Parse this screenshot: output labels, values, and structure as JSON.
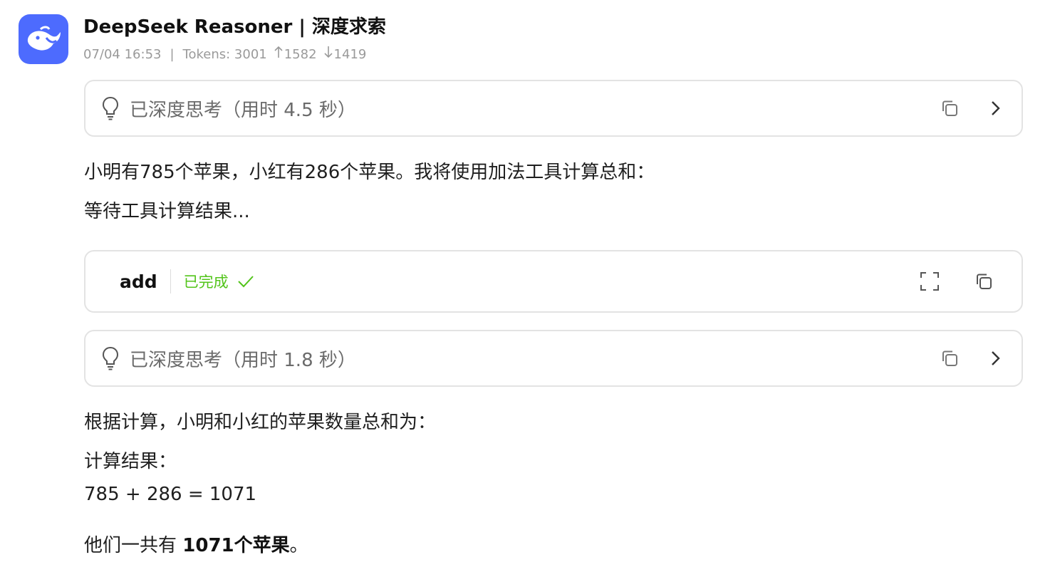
{
  "header": {
    "title": "DeepSeek Reasoner | 深度求索",
    "datetime": "07/04 16:53",
    "separator": "|",
    "tokens": "Tokens: 3001",
    "tokens_up": "1582",
    "tokens_down": "1419"
  },
  "thinking_blocks": [
    {
      "label": "已深度思考（用时 4.5 秒）"
    },
    {
      "label": "已深度思考（用时 1.8 秒）"
    }
  ],
  "tool_call": {
    "name": "add",
    "status": "已完成",
    "status_color": "#52c41a"
  },
  "message": {
    "line1": "小明有785个苹果，小红有286个苹果。我将使用加法工具计算总和：",
    "line2": "等待工具计算结果...",
    "line3": "根据计算，小明和小红的苹果数量总和为：",
    "line4": "计算结果：",
    "line5": "785 + 286 = 1071",
    "final_prefix": "他们一共有 ",
    "final_bold": "1071个苹果",
    "final_suffix": "。"
  },
  "colors": {
    "brand": "#4d6bfe",
    "border": "#e3e3e3",
    "muted": "#9a9a9a"
  },
  "icons": [
    "deepseek-whale-logo",
    "bulb-icon",
    "copy-icon",
    "chevron-right-icon",
    "expand-icon",
    "check-icon",
    "arrow-up-icon",
    "arrow-down-icon"
  ]
}
